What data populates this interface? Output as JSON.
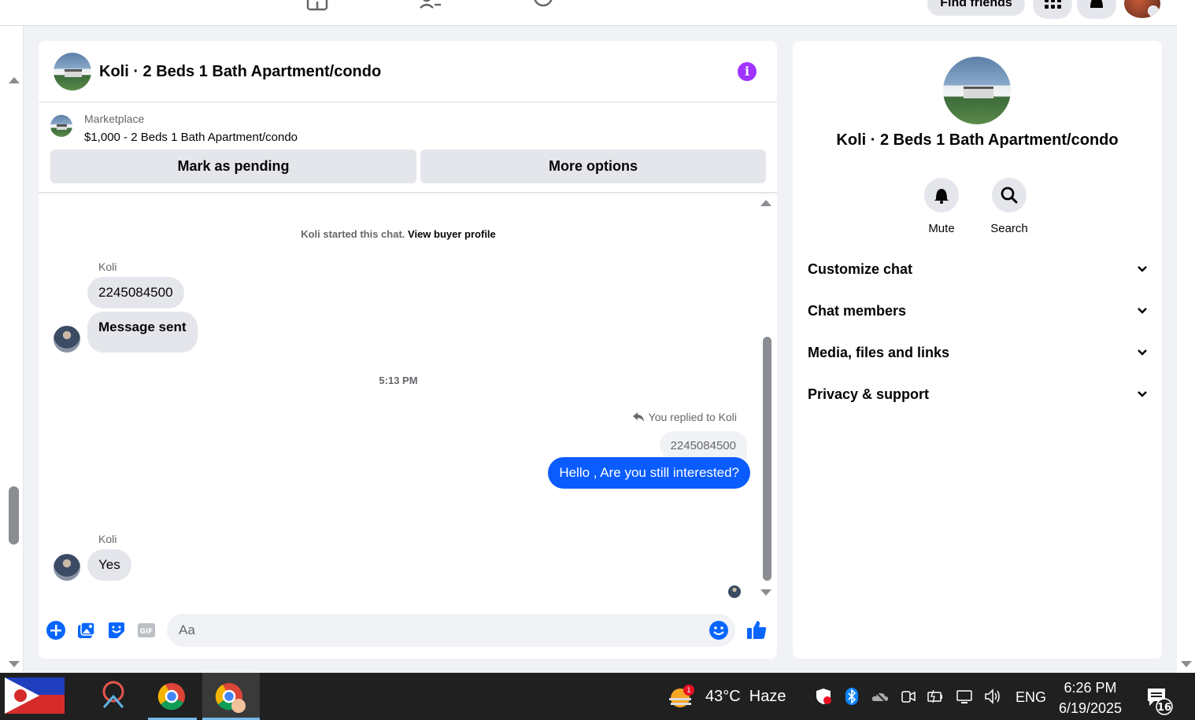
{
  "topnav": {
    "find_friends": "Find friends"
  },
  "chat": {
    "title": "Koli · 2 Beds 1 Bath Apartment/condo",
    "marketplace_label": "Marketplace",
    "listing": "$1,000 - 2 Beds 1 Bath Apartment/condo",
    "mark_pending": "Mark as pending",
    "more_options": "More options",
    "started_text": "Koli started this chat.",
    "view_buyer_profile": "View buyer profile",
    "messages": [
      {
        "sender": "Koli",
        "text": "2245084500"
      },
      {
        "text": "Message sent"
      }
    ],
    "timestamp": "5:13 PM",
    "replied_to": "You replied to Koli",
    "quoted_text": "2245084500",
    "outgoing": "Hello , Are you still interested?",
    "last_sender": "Koli",
    "last_message": "Yes",
    "composer_placeholder": "Aa"
  },
  "info_panel": {
    "title": "Koli · 2 Beds 1 Bath Apartment/condo",
    "mute": "Mute",
    "search": "Search",
    "sections": [
      "Customize chat",
      "Chat members",
      "Media, files and links",
      "Privacy & support"
    ]
  },
  "taskbar": {
    "weather_badge": "1",
    "weather": "43°C  Haze",
    "language": "ENG",
    "time": "6:26 PM",
    "date": "6/19/2025",
    "notification_count": "16"
  },
  "colors": {
    "accent_purple": "#a033ff",
    "messenger_blue": "#0a5cff",
    "fb_blue": "#0866ff"
  }
}
